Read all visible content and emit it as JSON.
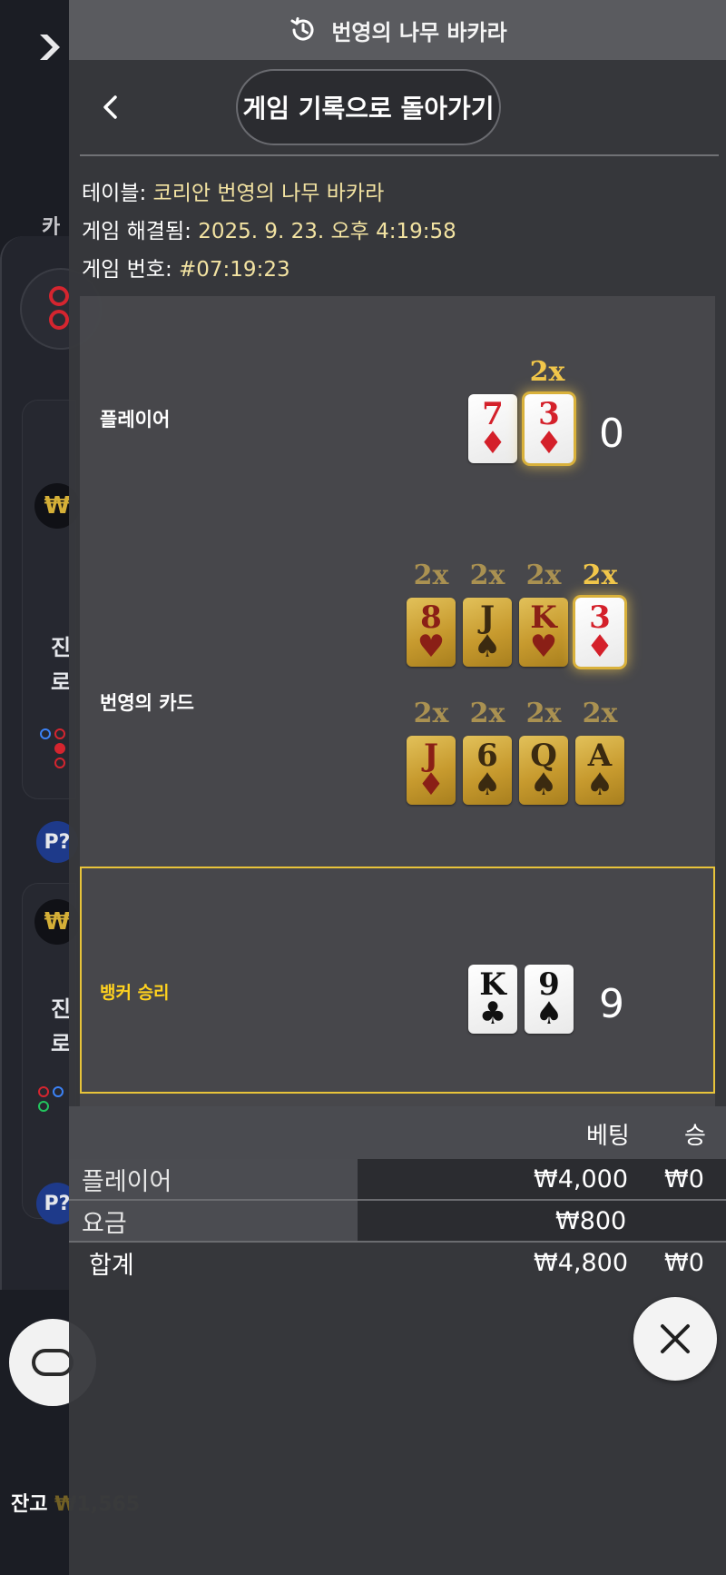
{
  "header": {
    "title": "번영의 나무 바카라"
  },
  "nav": {
    "back_label": "게임 기록으로 돌아가기"
  },
  "info": {
    "table_label": "테이블:",
    "table_value": "코리안 번영의 나무 바카라",
    "resolved_label": "게임 해결됨:",
    "resolved_value": "2025. 9. 23. 오후 4:19:58",
    "number_label": "게임 번호:",
    "number_value": "#07:19:23"
  },
  "player": {
    "label": "플레이어",
    "score": "0",
    "cards": [
      {
        "rank": "7",
        "suit": "♦",
        "color": "red",
        "multiplier": ""
      },
      {
        "rank": "3",
        "suit": "♦",
        "color": "red",
        "multiplier": "2x"
      }
    ]
  },
  "prosperity": {
    "label": "번영의 카드",
    "row1": [
      {
        "rank": "8",
        "suit": "♥",
        "color": "red",
        "multiplier": "2x"
      },
      {
        "rank": "J",
        "suit": "♠",
        "color": "black",
        "multiplier": "2x"
      },
      {
        "rank": "K",
        "suit": "♥",
        "color": "red",
        "multiplier": "2x"
      },
      {
        "rank": "3",
        "suit": "♦",
        "color": "red",
        "multiplier": "2x"
      }
    ],
    "row2": [
      {
        "rank": "J",
        "suit": "♦",
        "color": "red",
        "multiplier": "2x"
      },
      {
        "rank": "6",
        "suit": "♠",
        "color": "black",
        "multiplier": "2x"
      },
      {
        "rank": "Q",
        "suit": "♠",
        "color": "black",
        "multiplier": "2x"
      },
      {
        "rank": "A",
        "suit": "♠",
        "color": "black",
        "multiplier": "2x"
      }
    ]
  },
  "banker": {
    "label": "뱅커 승리",
    "score": "9",
    "cards": [
      {
        "rank": "K",
        "suit": "♣",
        "color": "black"
      },
      {
        "rank": "9",
        "suit": "♠",
        "color": "black"
      }
    ]
  },
  "bets": {
    "col_bet": "베팅",
    "col_win": "승",
    "rows": [
      {
        "label": "플레이어",
        "bet": "₩4,000",
        "win": "₩0"
      },
      {
        "label": "요금",
        "bet": "₩800",
        "win": ""
      },
      {
        "label": "합계",
        "bet": "₩4,800",
        "win": "₩0"
      }
    ]
  },
  "background": {
    "tab_label": "카",
    "badge": "₩",
    "avatar": "P?",
    "snippet_line1": "진",
    "snippet_line2": "로",
    "balance_label": "잔고",
    "balance_value": "₩1,565"
  },
  "colors": {
    "accent": "#e8c43a",
    "value_text": "#f3e3a2",
    "overlay": "#37383c"
  }
}
